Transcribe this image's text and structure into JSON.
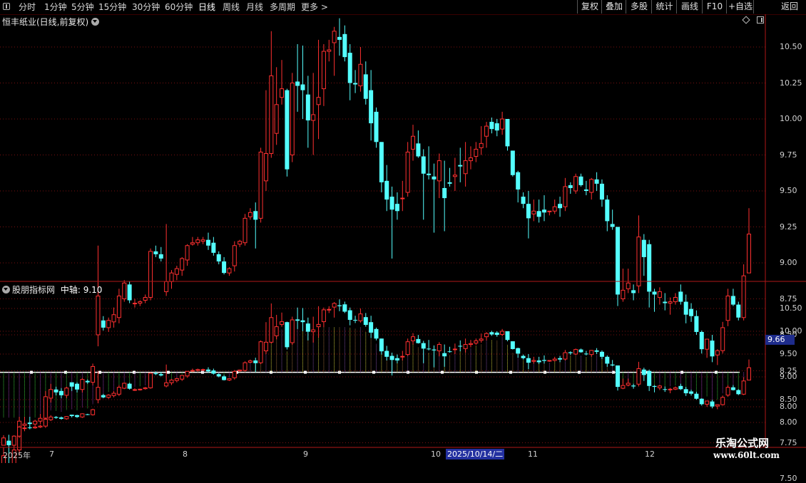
{
  "toolbar": {
    "periods": [
      "分时",
      "1分钟",
      "5分钟",
      "15分钟",
      "30分钟",
      "60分钟",
      "日线",
      "周线",
      "月线",
      "多周期",
      "更多 >"
    ],
    "active_period": "日线",
    "right_buttons": [
      "复权",
      "叠加",
      "多股",
      "统计",
      "画线",
      "F10",
      "+自选",
      "返回"
    ]
  },
  "main_chart": {
    "title": "恒丰纸业(日线,前复权)",
    "y_labels": [
      "10.50",
      "10.25",
      "10.00",
      "9.75",
      "9.50",
      "9.25",
      "9.00",
      "8.75",
      "8.50",
      "8.25",
      "8.00",
      "7.75",
      "7.50"
    ]
  },
  "sub_chart": {
    "title": "股朋指标网",
    "indicator_label": "中轴:",
    "indicator_value": "9.10",
    "y_labels": [
      "10.50",
      "10.00",
      "9.50",
      "9.00",
      "8.50",
      "8.00"
    ],
    "current_value": "9.66"
  },
  "x_axis": {
    "labels": [
      "2025年",
      "7",
      "8",
      "9",
      "10",
      "11",
      "12"
    ],
    "cursor_date": "2025/10/14/二"
  },
  "watermark": {
    "line1": "乐淘公式网",
    "line2": "www.60lt.com"
  },
  "colors": {
    "up": "#ff3030",
    "down": "#54ffff",
    "grid": "#7a1010",
    "axis": "#b01818",
    "midline": "#ffffff"
  },
  "chart_data": {
    "type": "candlestick",
    "series_ohlc": [
      [
        7.5,
        7.72,
        7.52,
        7.66
      ],
      [
        7.6,
        7.73,
        7.48,
        7.5
      ],
      [
        7.5,
        7.72,
        7.45,
        7.7
      ],
      [
        7.7,
        7.93,
        7.66,
        7.9
      ],
      [
        7.87,
        7.93,
        7.83,
        7.88
      ],
      [
        7.89,
        7.93,
        7.85,
        7.88
      ],
      [
        7.88,
        7.91,
        7.86,
        7.9
      ],
      [
        7.9,
        7.95,
        7.88,
        7.92
      ],
      [
        7.92,
        8.11,
        7.88,
        8.07
      ],
      [
        8.06,
        8.16,
        8.03,
        8.12
      ],
      [
        8.12,
        8.14,
        8.08,
        8.1
      ],
      [
        8.11,
        8.13,
        8.06,
        8.08
      ],
      [
        8.08,
        8.14,
        8.06,
        8.13
      ],
      [
        8.17,
        8.17,
        8.11,
        8.14
      ],
      [
        8.16,
        8.17,
        8.1,
        8.12
      ],
      [
        8.12,
        8.2,
        8.1,
        8.19
      ],
      [
        8.18,
        8.19,
        8.16,
        8.17
      ],
      [
        8.17,
        8.3,
        8.15,
        8.28
      ],
      [
        8.5,
        9.12,
        8.42,
        8.77
      ],
      [
        8.6,
        8.63,
        8.53,
        8.55
      ],
      [
        8.55,
        8.62,
        8.52,
        8.6
      ],
      [
        8.59,
        8.69,
        8.55,
        8.64
      ],
      [
        8.62,
        8.82,
        8.58,
        8.77
      ],
      [
        8.75,
        8.88,
        8.73,
        8.86
      ],
      [
        8.85,
        8.87,
        8.72,
        8.74
      ],
      [
        8.72,
        8.75,
        8.69,
        8.72
      ],
      [
        8.72,
        8.74,
        8.7,
        8.73
      ],
      [
        8.74,
        8.78,
        8.72,
        8.76
      ],
      [
        8.76,
        9.1,
        8.74,
        9.08
      ],
      [
        9.08,
        9.12,
        9.04,
        9.06
      ],
      [
        9.06,
        9.11,
        9.01,
        9.03
      ],
      [
        8.8,
        9.27,
        8.77,
        8.87
      ],
      [
        8.87,
        8.95,
        8.82,
        8.93
      ],
      [
        8.92,
        8.98,
        8.88,
        8.96
      ],
      [
        8.95,
        9.04,
        8.91,
        9.03
      ],
      [
        9.02,
        9.13,
        8.98,
        9.12
      ],
      [
        9.13,
        9.18,
        9.12,
        9.14
      ],
      [
        9.14,
        9.18,
        9.12,
        9.16
      ],
      [
        9.15,
        9.18,
        9.13,
        9.16
      ],
      [
        9.16,
        9.21,
        9.09,
        9.12
      ],
      [
        9.14,
        9.18,
        9.05,
        9.07
      ],
      [
        9.06,
        9.08,
        8.99,
        9.01
      ],
      [
        9.01,
        9.04,
        8.92,
        8.93
      ],
      [
        8.93,
        8.97,
        8.91,
        8.96
      ],
      [
        8.98,
        9.15,
        8.94,
        9.12
      ],
      [
        9.13,
        9.16,
        9.11,
        9.15
      ],
      [
        9.14,
        9.34,
        9.12,
        9.31
      ],
      [
        9.32,
        9.38,
        9.3,
        9.35
      ],
      [
        9.36,
        9.42,
        9.1,
        9.3
      ],
      [
        9.31,
        9.8,
        9.28,
        9.77
      ],
      [
        9.57,
        10.2,
        9.5,
        9.76
      ],
      [
        9.76,
        10.61,
        9.73,
        10.3
      ],
      [
        9.9,
        10.36,
        9.82,
        10.1
      ],
      [
        10.15,
        10.41,
        10.1,
        10.21
      ],
      [
        10.2,
        10.21,
        9.6,
        9.65
      ],
      [
        9.75,
        10.32,
        9.7,
        10.25
      ],
      [
        10.26,
        10.52,
        10.05,
        10.23
      ],
      [
        10.24,
        10.51,
        10.0,
        10.2
      ],
      [
        10.17,
        10.3,
        9.8,
        9.99
      ],
      [
        9.99,
        10.32,
        9.75,
        10.03
      ],
      [
        10.1,
        10.55,
        9.86,
        10.15
      ],
      [
        10.21,
        10.52,
        10.09,
        10.47
      ],
      [
        10.47,
        10.55,
        10.4,
        10.48
      ],
      [
        10.53,
        10.64,
        10.3,
        10.61
      ],
      [
        10.57,
        10.7,
        10.44,
        10.55
      ],
      [
        10.59,
        10.65,
        10.4,
        10.43
      ],
      [
        10.46,
        10.52,
        10.13,
        10.25
      ],
      [
        10.25,
        10.34,
        10.18,
        10.24
      ],
      [
        10.23,
        10.5,
        10.19,
        10.38
      ],
      [
        10.31,
        10.4,
        10.1,
        10.14
      ],
      [
        10.2,
        10.34,
        9.85,
        9.97
      ],
      [
        10.05,
        10.08,
        9.8,
        9.84
      ],
      [
        9.84,
        9.84,
        9.49,
        9.56
      ],
      [
        9.57,
        9.68,
        9.36,
        9.44
      ],
      [
        9.46,
        9.53,
        9.03,
        9.37
      ],
      [
        9.41,
        9.49,
        9.3,
        9.36
      ],
      [
        9.45,
        9.57,
        9.36,
        9.45
      ],
      [
        9.49,
        9.84,
        9.46,
        9.77
      ],
      [
        9.79,
        9.96,
        9.71,
        9.88
      ],
      [
        9.83,
        9.92,
        9.73,
        9.74
      ],
      [
        9.74,
        9.79,
        9.3,
        9.62
      ],
      [
        9.62,
        9.81,
        9.58,
        9.61
      ],
      [
        9.6,
        9.69,
        9.21,
        9.58
      ],
      [
        9.57,
        9.76,
        9.45,
        9.71
      ],
      [
        9.52,
        9.71,
        9.22,
        9.45
      ],
      [
        9.56,
        9.66,
        9.53,
        9.55
      ],
      [
        9.6,
        9.73,
        9.5,
        9.61
      ],
      [
        9.68,
        9.8,
        9.56,
        9.67
      ],
      [
        9.62,
        9.84,
        9.53,
        9.71
      ],
      [
        9.71,
        9.81,
        9.65,
        9.73
      ],
      [
        9.74,
        9.84,
        9.7,
        9.79
      ],
      [
        9.8,
        9.95,
        9.75,
        9.83
      ],
      [
        9.88,
        9.98,
        9.8,
        9.95
      ],
      [
        9.98,
        10.01,
        9.9,
        9.93
      ],
      [
        9.97,
        10.0,
        9.88,
        9.92
      ],
      [
        9.93,
        10.05,
        9.89,
        10.0
      ],
      [
        10.0,
        10.0,
        9.78,
        9.81
      ],
      [
        9.78,
        9.78,
        9.6,
        9.61
      ],
      [
        9.63,
        9.64,
        9.42,
        9.51
      ],
      [
        9.46,
        9.49,
        9.38,
        9.41
      ],
      [
        9.41,
        9.5,
        9.17,
        9.31
      ],
      [
        9.34,
        9.44,
        9.29,
        9.36
      ],
      [
        9.36,
        9.44,
        9.28,
        9.32
      ],
      [
        9.37,
        9.47,
        9.29,
        9.35
      ],
      [
        9.36,
        9.36,
        9.33,
        9.36
      ],
      [
        9.36,
        9.44,
        9.34,
        9.39
      ],
      [
        9.41,
        9.46,
        9.32,
        9.38
      ],
      [
        9.39,
        9.59,
        9.36,
        9.53
      ],
      [
        9.54,
        9.56,
        9.48,
        9.52
      ],
      [
        9.5,
        9.62,
        9.48,
        9.6
      ],
      [
        9.6,
        9.62,
        9.53,
        9.54
      ],
      [
        9.51,
        9.57,
        9.47,
        9.5
      ],
      [
        9.49,
        9.59,
        9.44,
        9.58
      ],
      [
        9.58,
        9.63,
        9.5,
        9.55
      ],
      [
        9.55,
        9.58,
        9.39,
        9.44
      ],
      [
        9.44,
        9.47,
        9.22,
        9.29
      ],
      [
        9.27,
        9.37,
        9.23,
        9.25
      ],
      [
        9.25,
        9.25,
        8.7,
        8.78
      ],
      [
        8.75,
        8.96,
        8.73,
        8.81
      ],
      [
        8.82,
        8.96,
        8.79,
        8.86
      ],
      [
        8.81,
        8.85,
        8.74,
        8.79
      ],
      [
        8.84,
        9.33,
        8.79,
        9.18
      ],
      [
        9.16,
        9.2,
        8.91,
        9.04
      ],
      [
        9.13,
        9.16,
        8.69,
        8.8
      ],
      [
        8.8,
        8.82,
        8.66,
        8.78
      ],
      [
        8.76,
        8.83,
        8.71,
        8.8
      ],
      [
        8.73,
        8.79,
        8.67,
        8.72
      ],
      [
        8.72,
        8.76,
        8.64,
        8.73
      ],
      [
        8.73,
        8.79,
        8.71,
        8.76
      ],
      [
        8.8,
        8.85,
        8.71,
        8.73
      ],
      [
        8.73,
        8.78,
        8.58,
        8.64
      ],
      [
        8.68,
        8.72,
        8.59,
        8.63
      ],
      [
        8.63,
        8.67,
        8.5,
        8.52
      ],
      [
        8.52,
        8.53,
        8.37,
        8.4
      ],
      [
        8.4,
        8.46,
        8.34,
        8.47
      ],
      [
        8.46,
        8.5,
        8.31,
        8.35
      ],
      [
        8.36,
        8.4,
        8.29,
        8.39
      ],
      [
        8.39,
        8.59,
        8.37,
        8.55
      ],
      [
        8.6,
        8.82,
        8.56,
        8.77
      ],
      [
        8.77,
        8.82,
        8.7,
        8.71
      ],
      [
        8.71,
        8.73,
        8.6,
        8.62
      ],
      [
        8.62,
        8.99,
        8.6,
        8.91
      ],
      [
        8.93,
        9.38,
        8.93,
        9.2
      ]
    ]
  }
}
